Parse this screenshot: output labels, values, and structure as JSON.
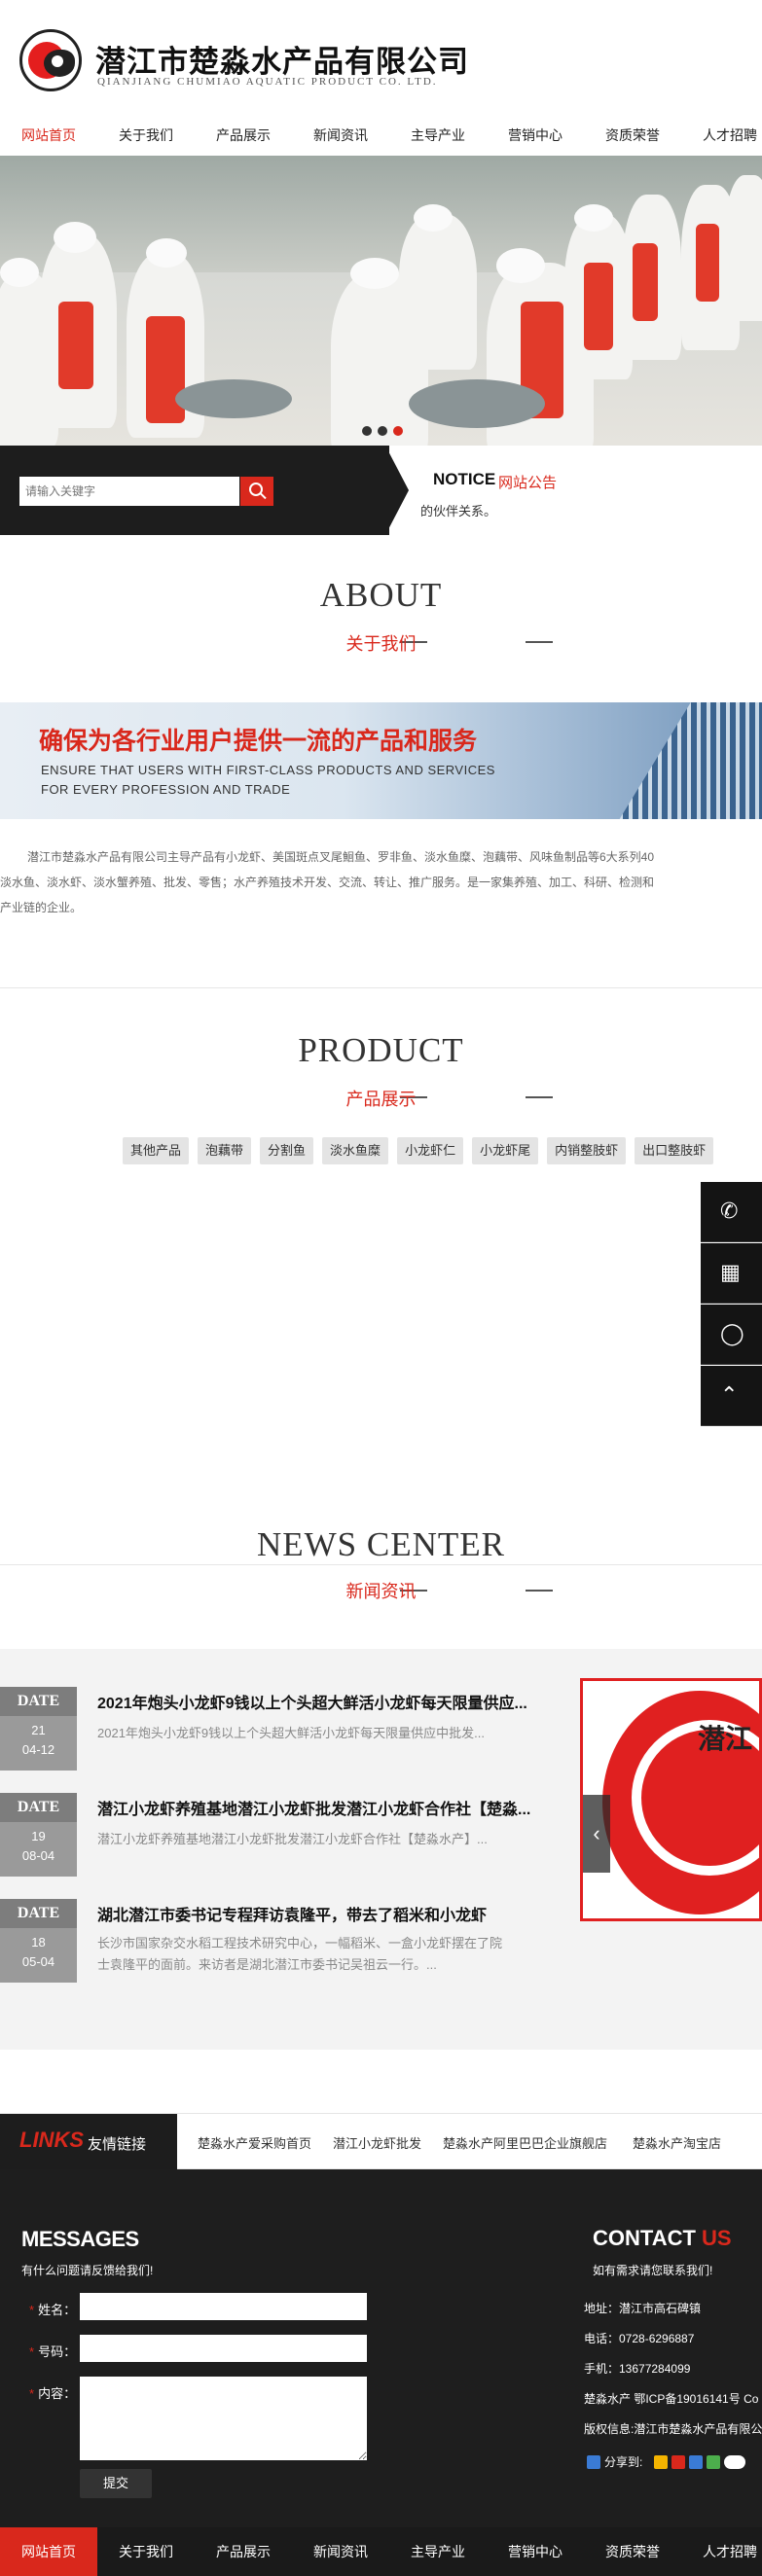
{
  "header": {
    "company_cn": "潜江市楚淼水产品有限公司",
    "company_en": "QIANJIANG CHUMIAO AQUATIC PRODUCT CO. LTD."
  },
  "nav": {
    "items": [
      "网站首页",
      "关于我们",
      "产品展示",
      "新闻资讯",
      "主导产业",
      "营销中心",
      "资质荣誉",
      "人才招聘"
    ]
  },
  "search": {
    "placeholder": "请输入关键字"
  },
  "notice": {
    "label_en": "NOTICE",
    "label_cn": "网站公告",
    "text": "的伙伴关系。"
  },
  "about": {
    "title_en": "ABOUT",
    "title_cn": "关于我们",
    "slogan_cn": "确保为各行业用户提供一流的产品和服务",
    "slogan_en_1": "ENSURE THAT USERS WITH FIRST-CLASS PRODUCTS AND SERVICES",
    "slogan_en_2": "FOR EVERY PROFESSION AND TRADE",
    "text_1": "潜江市楚淼水产品有限公司主导产品有小龙虾、美国斑点叉尾鮰鱼、罗非鱼、淡水鱼糜、泡藕带、风味鱼制品等6大系列40",
    "text_2": "淡水鱼、淡水虾、淡水蟹养殖、批发、零售；水产养殖技术开发、交流、转让、推广服务。是一家集养殖、加工、科研、检测和",
    "text_3": "产业链的企业。"
  },
  "product": {
    "title_en": "PRODUCT",
    "title_cn": "产品展示",
    "tags": [
      "其他产品",
      "泡藕带",
      "分割鱼",
      "淡水鱼糜",
      "小龙虾仁",
      "小龙虾尾",
      "内销整肢虾",
      "出口整肢虾"
    ]
  },
  "float_bar": {
    "icons": [
      "phone-icon",
      "qrcode-icon",
      "qq-icon",
      "back-to-top-icon"
    ]
  },
  "news": {
    "title_en": "NEWS CENTER",
    "title_cn": "新闻资讯",
    "date_label": "DATE",
    "items": [
      {
        "day": "21",
        "month": "04-12",
        "title": "2021年炮头小龙虾9钱以上个头超大鲜活小龙虾每天限量供应...",
        "summary": "2021年炮头小龙虾9钱以上个头超大鲜活小龙虾每天限量供应中批发..."
      },
      {
        "day": "19",
        "month": "08-04",
        "title": "潜江小龙虾养殖基地潜江小龙虾批发潜江小龙虾合作社【楚淼...",
        "summary": "潜江小龙虾养殖基地潜江小龙虾批发潜江小龙虾合作社【楚淼水产】..."
      },
      {
        "day": "18",
        "month": "05-04",
        "title": "湖北潜江市委书记专程拜访袁隆平，带去了稻米和小龙虾",
        "summary_1": "长沙市国家杂交水稻工程技术研究中心，一幅稻米、一盒小龙虾摆在了院",
        "summary_2": "士袁隆平的面前。来访者是湖北潜江市委书记吴祖云一行。..."
      }
    ],
    "image_text": "潜江"
  },
  "links": {
    "label_en": "LINKS",
    "label_cn": "友情链接",
    "items": [
      "楚淼水产爱采购首页",
      "潜江小龙虾批发",
      "楚淼水产阿里巴巴企业旗舰店",
      "楚淼水产淘宝店"
    ]
  },
  "messages": {
    "title": "MESSAGES",
    "subtitle": "有什么问题请反馈给我们!",
    "name_label": "姓名：",
    "phone_label": "号码：",
    "content_label": "内容：",
    "required_mark": "*",
    "submit_label": "提交"
  },
  "contact": {
    "title_1": "CONTACT",
    "title_2": " US",
    "subtitle": "如有需求请您联系我们!",
    "address": "地址：潜江市高石碑镇",
    "tel": "电话：0728-6296887",
    "mobile": "手机：13677284099",
    "icp": "楚淼水产 鄂ICP备19016141号 Co",
    "copyright": "版权信息:潜江市楚淼水产品有限公",
    "share_label": "分享到:"
  },
  "colors": {
    "accent": "#d9281c",
    "dark": "#1d1d1d"
  }
}
